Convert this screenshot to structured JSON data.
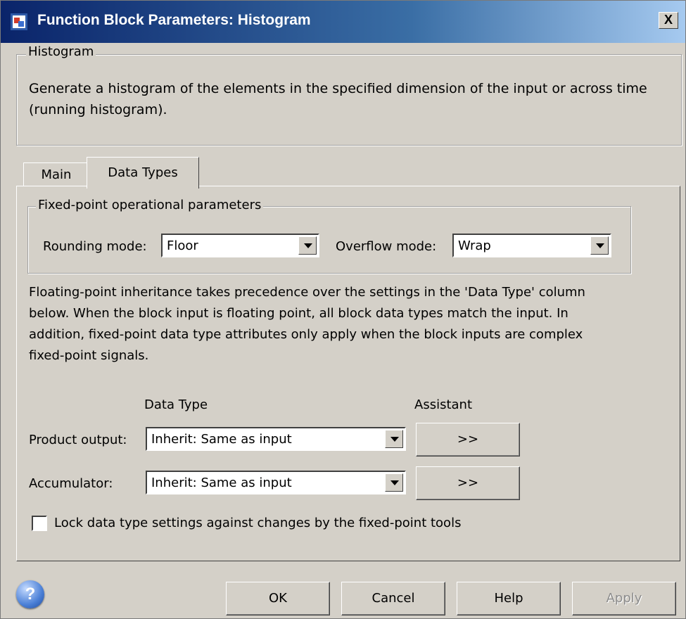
{
  "window": {
    "title": "Function Block Parameters: Histogram",
    "close_label": "X"
  },
  "description_group": {
    "legend": "Histogram",
    "lines": [
      "Generate a histogram of the elements in the specified dimension of the input or across time",
      "(running histogram)."
    ]
  },
  "tabs": [
    {
      "label": "Main",
      "active": false
    },
    {
      "label": "Data Types",
      "active": true
    }
  ],
  "fixed_point": {
    "legend": "Fixed-point operational parameters",
    "rounding_label": "Rounding mode:",
    "rounding_value": "Floor",
    "overflow_label": "Overflow mode:",
    "overflow_value": "Wrap"
  },
  "inheritance_note": [
    "Floating-point inheritance takes precedence over the settings in the 'Data Type' column",
    "below. When the block input is floating point, all block data types match the input. In",
    "addition, fixed-point data type attributes only apply when the block inputs are complex",
    "fixed-point signals."
  ],
  "table": {
    "data_type_header": "Data Type",
    "assistant_header": "Assistant",
    "rows": [
      {
        "label": "Product output:",
        "value": "Inherit: Same as input",
        "assistant": ">>"
      },
      {
        "label": "Accumulator:",
        "value": "Inherit: Same as input",
        "assistant": ">>"
      }
    ]
  },
  "lock_checkbox": {
    "label": "Lock data type settings against changes by the fixed-point tools",
    "checked": false
  },
  "buttons": {
    "ok": "OK",
    "cancel": "Cancel",
    "help": "Help",
    "apply": "Apply",
    "apply_enabled": false
  },
  "help_icon": {
    "glyph": "?"
  }
}
